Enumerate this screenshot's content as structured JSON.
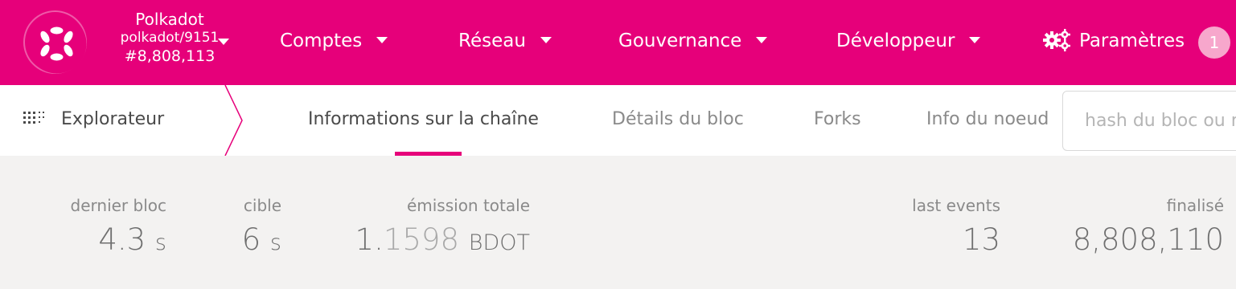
{
  "topbar": {
    "chain": {
      "name": "Polkadot",
      "runtime": "polkadot/9151",
      "block": "#8,808,113"
    },
    "nav": [
      {
        "label": "Comptes"
      },
      {
        "label": "Réseau"
      },
      {
        "label": "Gouvernance"
      },
      {
        "label": "Développeur"
      }
    ],
    "settings_label": "Paramètres",
    "settings_badge": "1",
    "accent_color": "#e6007a"
  },
  "subnav": {
    "section_label": "Explorateur",
    "tabs": [
      {
        "label": "Informations sur la chaîne",
        "active": true
      },
      {
        "label": "Détails du bloc",
        "active": false
      },
      {
        "label": "Forks",
        "active": false
      },
      {
        "label": "Info du noeud",
        "active": false
      }
    ],
    "search_placeholder": "hash du bloc ou numéro à requêter"
  },
  "stats": {
    "last_block": {
      "label": "dernier bloc",
      "value": "4.3",
      "unit": "s"
    },
    "target": {
      "label": "cible",
      "value": "6",
      "unit": "s"
    },
    "total_issuance": {
      "label": "émission totale",
      "value_main": "1.",
      "value_dim": "1598",
      "unit": "BDOT"
    },
    "last_events": {
      "label": "last events",
      "value": "13"
    },
    "finalized": {
      "label": "finalisé",
      "value": "8,808,110"
    }
  }
}
